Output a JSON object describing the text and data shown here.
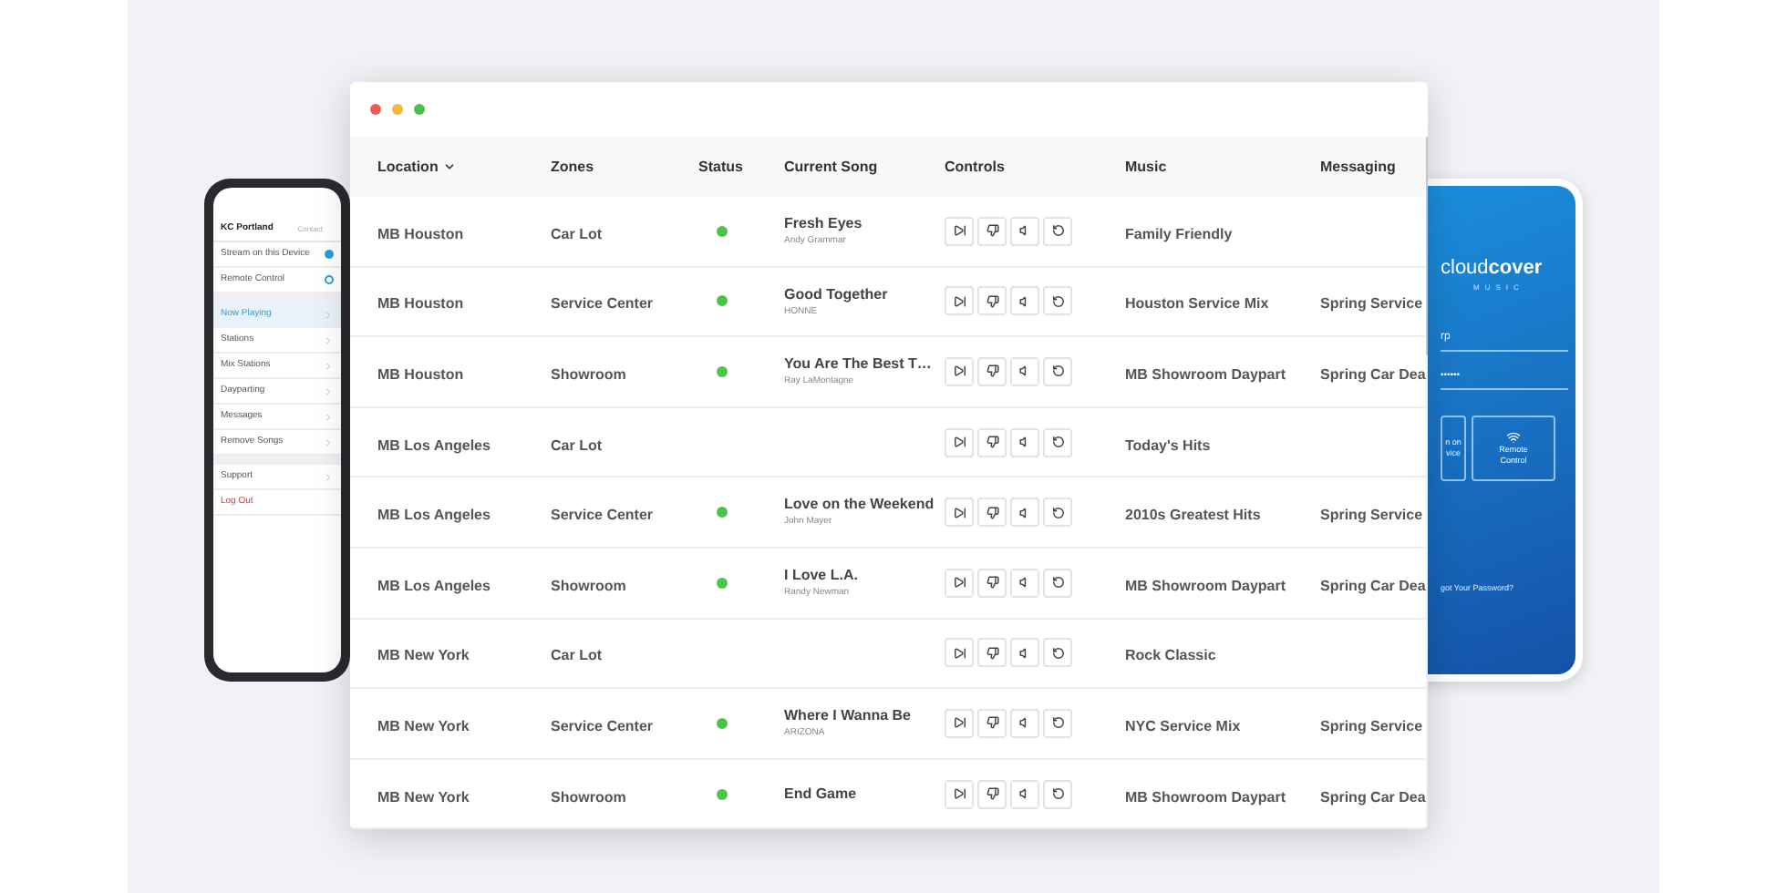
{
  "left_phone": {
    "header": {
      "title": "KC Portland",
      "action": "Contact"
    },
    "sections": [
      {
        "items": [
          {
            "kind": "radio",
            "label": "Stream on this Device",
            "selected": true
          },
          {
            "kind": "radio",
            "label": "Remote Control",
            "selected": false
          }
        ]
      },
      {
        "items": [
          {
            "kind": "link",
            "label": "Now Playing",
            "selected": true
          },
          {
            "kind": "link",
            "label": "Stations",
            "selected": false
          },
          {
            "kind": "link",
            "label": "Mix Stations",
            "selected": false
          },
          {
            "kind": "link",
            "label": "Dayparting",
            "selected": false
          },
          {
            "kind": "link",
            "label": "Messages",
            "selected": false
          },
          {
            "kind": "link",
            "label": "Remove Songs",
            "selected": false
          }
        ]
      },
      {
        "items": [
          {
            "kind": "link",
            "label": "Support",
            "selected": false
          },
          {
            "kind": "danger",
            "label": "Log Out",
            "selected": false
          }
        ]
      }
    ]
  },
  "right_phone": {
    "logo": "cloud**cover**",
    "logo_sub": "MUSIC",
    "username": "rp",
    "password": "••••••",
    "tiles": [
      {
        "kind": "plain",
        "lines": [
          "n on",
          "vice"
        ]
      },
      {
        "kind": "wifi",
        "lines": [
          "Remote",
          "Control"
        ]
      }
    ],
    "forgot_link": "got Your Password?"
  },
  "table": {
    "columns": [
      {
        "label": "Location",
        "sortable": true
      },
      {
        "label": "Zones",
        "sortable": false
      },
      {
        "label": "Status",
        "sortable": false
      },
      {
        "label": "Current Song",
        "sortable": false
      },
      {
        "label": "Controls",
        "sortable": false
      },
      {
        "label": "Music",
        "sortable": false
      },
      {
        "label": "Messaging",
        "sortable": false
      }
    ],
    "rows": [
      {
        "location": "MB Houston",
        "zone": "Car Lot",
        "playing": true,
        "song": "Fresh Eyes",
        "artist": "Andy Grammar",
        "music": "Family Friendly",
        "messaging": ""
      },
      {
        "location": "MB Houston",
        "zone": "Service Center",
        "playing": true,
        "song": "Good Together",
        "artist": "HONNE",
        "music": "Houston Service Mix",
        "messaging": "Spring Service"
      },
      {
        "location": "MB Houston",
        "zone": "Showroom",
        "playing": true,
        "song": "You Are The Best T…",
        "artist": "Ray LaMontagne",
        "music": "MB Showroom Daypart",
        "messaging": "Spring Car Dea"
      },
      {
        "location": "MB Los Angeles",
        "zone": "Car Lot",
        "playing": false,
        "song": "",
        "artist": "",
        "music": "Today's Hits",
        "messaging": ""
      },
      {
        "location": "MB Los Angeles",
        "zone": "Service Center",
        "playing": true,
        "song": "Love on the Weekend",
        "artist": "John Mayer",
        "music": "2010s Greatest Hits",
        "messaging": "Spring Service"
      },
      {
        "location": "MB Los Angeles",
        "zone": "Showroom",
        "playing": true,
        "song": "I Love L.A.",
        "artist": "Randy Newman",
        "music": "MB Showroom Daypart",
        "messaging": "Spring Car Dea"
      },
      {
        "location": "MB New York",
        "zone": "Car Lot",
        "playing": false,
        "song": "",
        "artist": "",
        "music": "Rock Classic",
        "messaging": ""
      },
      {
        "location": "MB New York",
        "zone": "Service Center",
        "playing": true,
        "song": "Where I Wanna Be",
        "artist": "ARIZONA",
        "music": "NYC Service Mix",
        "messaging": "Spring Service"
      },
      {
        "location": "MB New York",
        "zone": "Showroom",
        "playing": true,
        "song": "End Game",
        "artist": "",
        "music": "MB Showroom Daypart",
        "messaging": "Spring Car Dea"
      }
    ]
  }
}
